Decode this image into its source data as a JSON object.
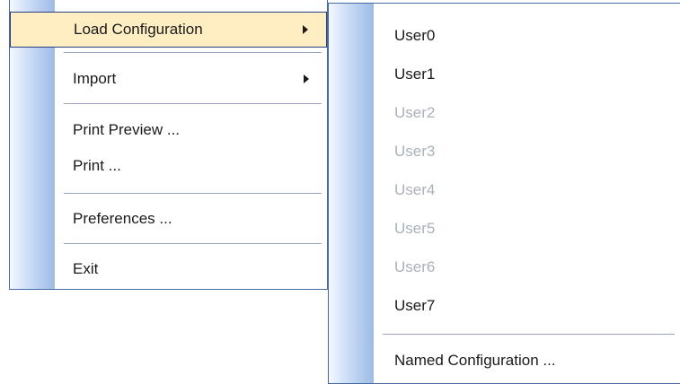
{
  "main_menu": {
    "items": [
      {
        "label": "Load Configuration",
        "has_submenu": true,
        "highlighted": true
      },
      {
        "label": "Import",
        "has_submenu": true
      },
      {
        "label": "Print Preview ..."
      },
      {
        "label": "Print ..."
      },
      {
        "label": "Preferences ..."
      },
      {
        "label": "Exit"
      }
    ]
  },
  "sub_menu": {
    "items": [
      {
        "label": "User0",
        "enabled": true
      },
      {
        "label": "User1",
        "enabled": true
      },
      {
        "label": "User2",
        "enabled": false
      },
      {
        "label": "User3",
        "enabled": false
      },
      {
        "label": "User4",
        "enabled": false
      },
      {
        "label": "User5",
        "enabled": false
      },
      {
        "label": "User6",
        "enabled": false
      },
      {
        "label": "User7",
        "enabled": true
      },
      {
        "label": "Named Configuration ...",
        "enabled": true
      }
    ]
  },
  "colors": {
    "highlight_fill": "#ffeec2",
    "highlight_border": "#2a3f80",
    "menu_border": "#4a6aa5",
    "disabled_text": "#aab1bd"
  }
}
